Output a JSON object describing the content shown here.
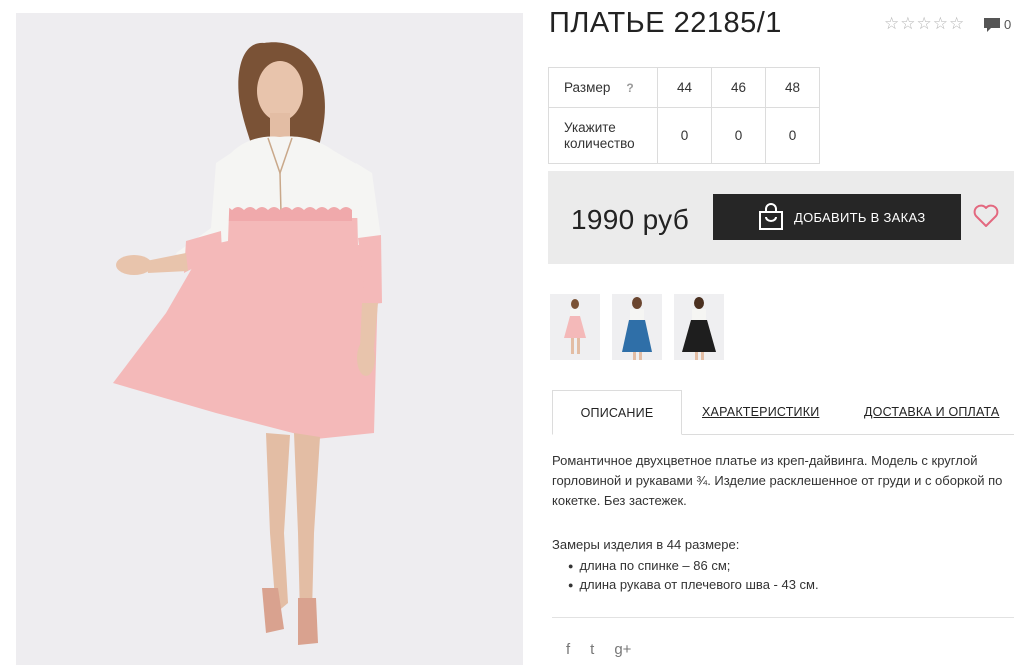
{
  "product": {
    "title": "ПЛАТЬЕ 22185/1",
    "rating_stars": "☆☆☆☆☆",
    "comment_count": "0"
  },
  "size_table": {
    "size_label": "Размер",
    "help_mark": "?",
    "qty_label_line1": "Укажите",
    "qty_label_line2": "количество",
    "sizes": [
      "44",
      "46",
      "48"
    ],
    "quantities": [
      "0",
      "0",
      "0"
    ]
  },
  "purchase": {
    "price": "1990 руб",
    "order_button": "ДОБАВИТЬ В ЗАКАЗ"
  },
  "tabs": {
    "description": "ОПИСАНИЕ",
    "characteristics": "ХАРАКТЕРИСТИКИ",
    "delivery": "ДОСТАВКА И ОПЛАТА"
  },
  "description": {
    "text": "Романтичное двухцветное платье из креп-дайвинга. Модель с круглой горловиной и рукавами ¾. Изделие расклешенное от груди и с оборкой по кокетке. Без застежек.",
    "measures_title": "Замеры изделия в 44 размере:",
    "measures": [
      "длина по спинке – 86 см;",
      "длина рукава от плечевого шва - 43 см."
    ]
  },
  "social": {
    "facebook": "f",
    "twitter": "t",
    "google": "g+"
  },
  "colors": {
    "button_bg": "#262626",
    "price_box_bg": "#ebebeb",
    "heart": "#e3687f",
    "dress_pink": "#f4b9b9",
    "dress_white": "#f5f5f3"
  }
}
